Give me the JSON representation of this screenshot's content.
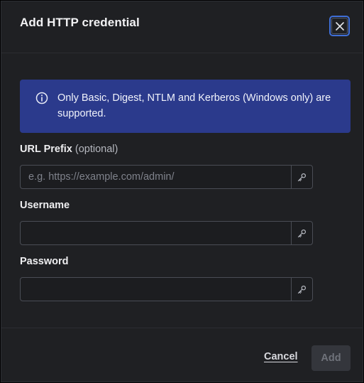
{
  "dialog": {
    "title": "Add HTTP credential",
    "close_icon": "close-icon"
  },
  "notice": {
    "icon": "info-icon",
    "text": "Only Basic, Digest, NTLM and Kerberos (Windows only) are supported."
  },
  "fields": {
    "url_prefix": {
      "label": "URL Prefix",
      "optional_text": "(optional)",
      "value": "",
      "placeholder": "e.g. https://example.com/admin/",
      "action_icon": "key-icon"
    },
    "username": {
      "label": "Username",
      "value": "",
      "placeholder": "",
      "action_icon": "key-icon"
    },
    "password": {
      "label": "Password",
      "value": "",
      "placeholder": "",
      "action_icon": "key-icon"
    }
  },
  "footer": {
    "cancel_label": "Cancel",
    "add_label": "Add",
    "add_enabled": false
  },
  "colors": {
    "background": "#1f2023",
    "notice_background": "#2b3a8c",
    "focus_ring": "#3f6fd8",
    "disabled_button": "#34363c"
  }
}
